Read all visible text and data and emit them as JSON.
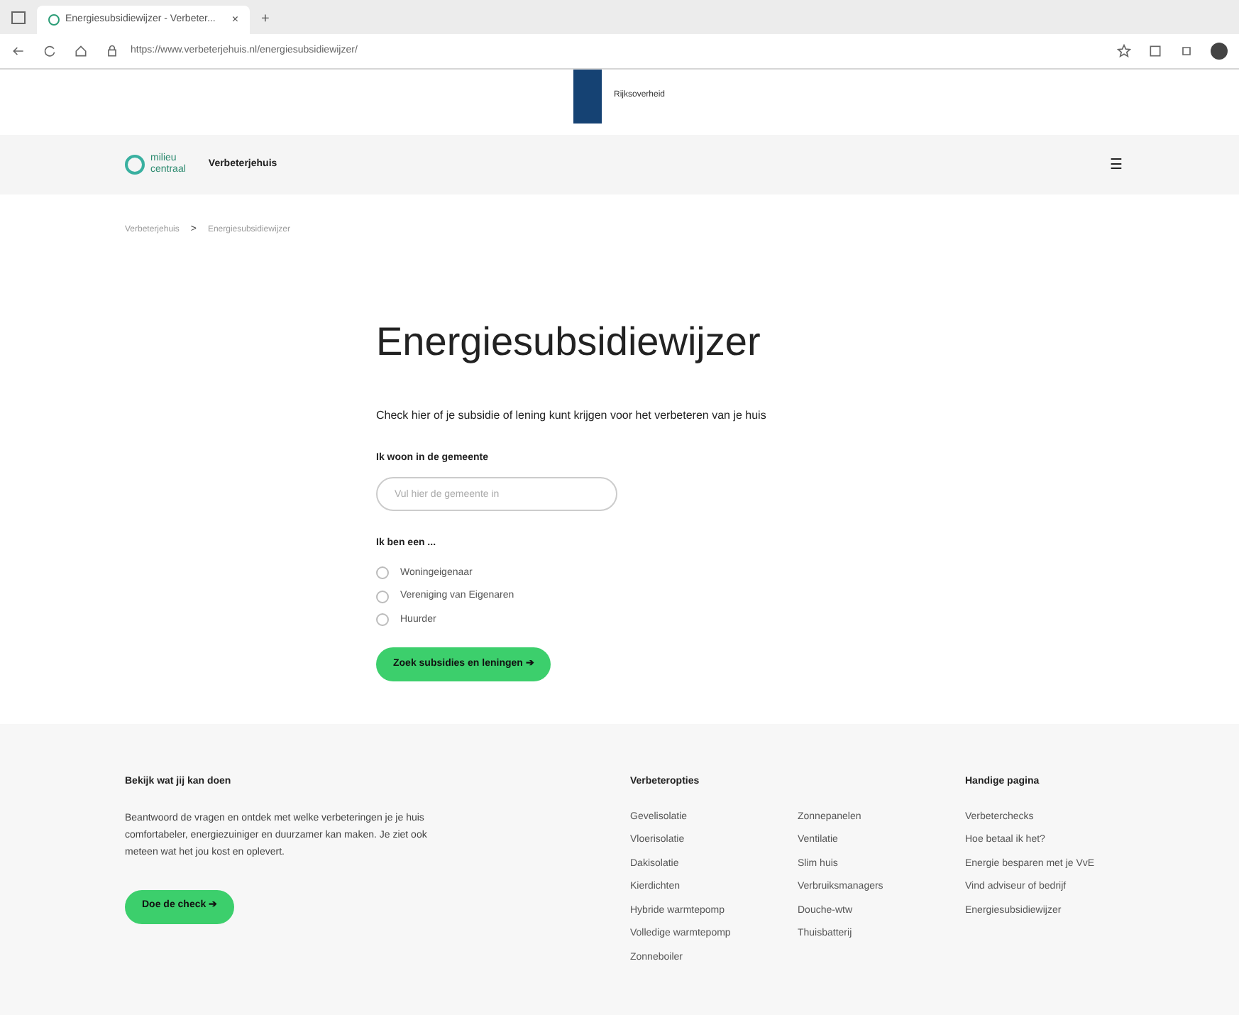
{
  "browser": {
    "tab_title": "Energiesubsidiewijzer - Verbeter...",
    "close": "×",
    "new_tab": "+",
    "url": "https://www.verbeterjehuis.nl/energiesubsidiewijzer/"
  },
  "gov_banner": {
    "label": "Rijksoverheid"
  },
  "header": {
    "logo_line_1": "milieu",
    "logo_line_2": "centraal",
    "site": "Verbeterjehuis",
    "menu": "☰"
  },
  "breadcrumb": [
    {
      "label": "Verbeterjehuis"
    },
    {
      "label": "Energiesubsidiewijzer"
    }
  ],
  "breadcrumb_separator": ">",
  "title": "Energiesubsidiewijzer",
  "intro": "Check hier of je subsidie of lening kunt krijgen voor het verbeteren van je huis",
  "municipality": {
    "label": "Ik woon in de gemeente",
    "placeholder": "Vul hier de gemeente in"
  },
  "role": {
    "label": "Ik ben een ...",
    "options": [
      {
        "label": "Woningeigenaar",
        "selected": false
      },
      {
        "label": "Vereniging van Eigenaren",
        "selected": false
      },
      {
        "label": "Huurder",
        "selected": false
      }
    ]
  },
  "submit": {
    "label": "Zoek subsidies en leningen",
    "arrow": "➔"
  },
  "footer": {
    "check": {
      "heading": "Bekijk wat jij kan doen",
      "text": "Beantwoord de vragen en ontdek met welke verbeteringen je je huis comfortabeler, energiezuiniger en duurzamer kan maken. Je ziet ook meteen wat het jou kost en oplevert.",
      "button": "Doe de check",
      "arrow": "➔"
    },
    "options": {
      "heading": "Verbeteropties",
      "column_1": [
        "Gevelisolatie",
        "Vloerisolatie",
        "Dakisolatie",
        "Kierdichten",
        "Hybride warmtepomp",
        "Volledige warmtepomp",
        "Zonneboiler"
      ],
      "column_2": [
        "Zonnepanelen",
        "Ventilatie",
        "Slim huis",
        "Verbruiksmanagers",
        "Douche-wtw",
        "Thuisbatterij"
      ]
    },
    "pages": {
      "heading": "Handige pagina",
      "links": [
        "Verbeterchecks",
        "Hoe betaal ik het?",
        "Energie besparen met je VvE",
        "Vind adviseur of bedrijf",
        "Energiesubsidiewijzer"
      ]
    }
  }
}
